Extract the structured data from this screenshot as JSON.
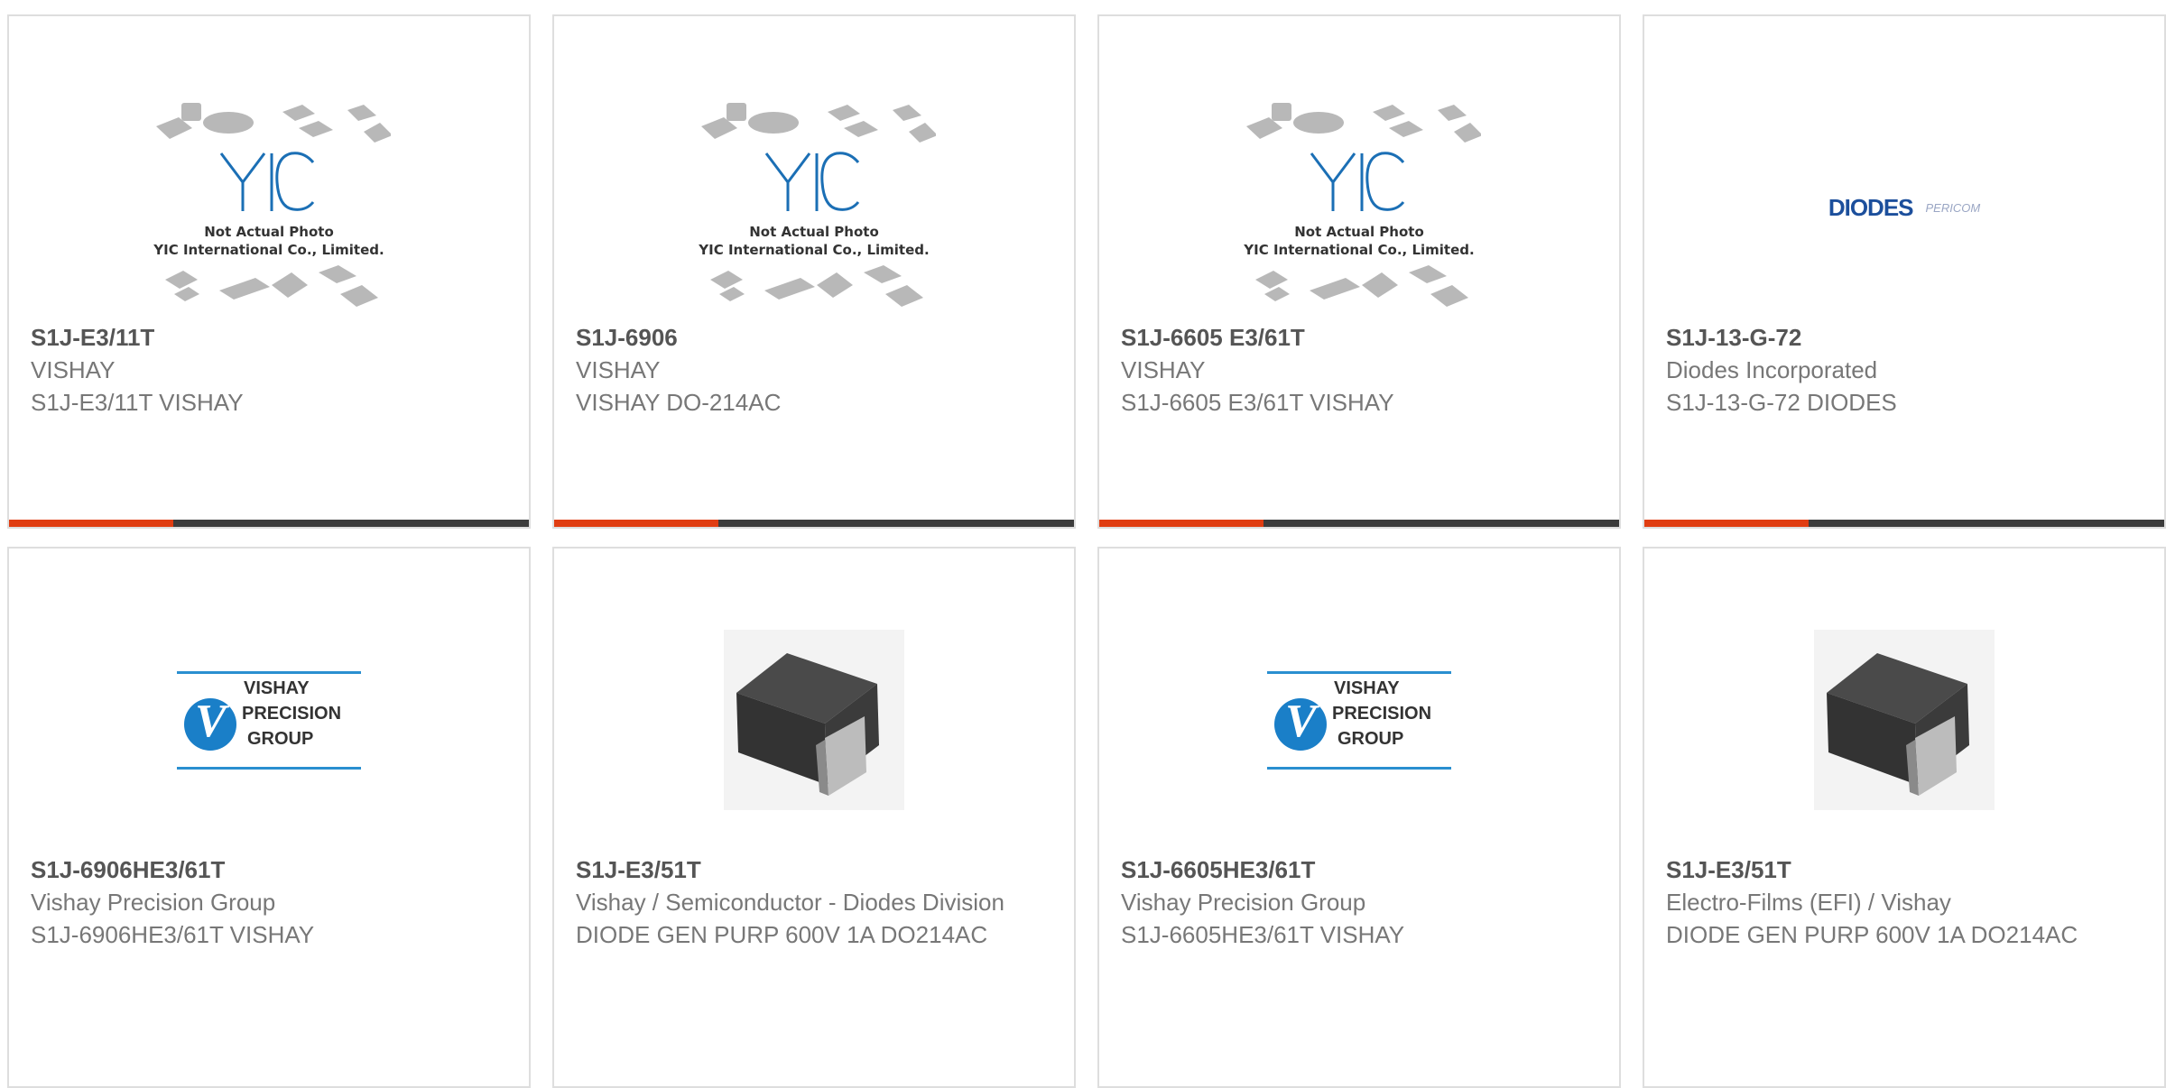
{
  "colors": {
    "accent": "#e03d12",
    "bar": "#3c3c3c",
    "border": "#dedede"
  },
  "yic_placeholder": {
    "line1": "Not Actual Photo",
    "line2": "YIC International Co., Limited."
  },
  "diodes_logo": {
    "brand": "DIODES",
    "sub": "PERICOM"
  },
  "vishay_logo": {
    "w1": "VISHAY",
    "w2": "PRECISION",
    "w3": "GROUP"
  },
  "cards": [
    {
      "pn": "S1J-E3/11T",
      "mfr": "VISHAY",
      "desc": "S1J-E3/11T VISHAY",
      "image": "yic-placeholder"
    },
    {
      "pn": "S1J-6906",
      "mfr": "VISHAY",
      "desc": "VISHAY DO-214AC",
      "image": "yic-placeholder"
    },
    {
      "pn": "S1J-6605 E3/61T",
      "mfr": "VISHAY",
      "desc": "S1J-6605 E3/61T VISHAY",
      "image": "yic-placeholder"
    },
    {
      "pn": "S1J-13-G-72",
      "mfr": "Diodes Incorporated",
      "desc": "S1J-13-G-72 DIODES",
      "image": "diodes-logo"
    },
    {
      "pn": "S1J-6906HE3/61T",
      "mfr": "Vishay Precision Group",
      "desc": "S1J-6906HE3/61T VISHAY",
      "image": "vishay-logo"
    },
    {
      "pn": "S1J-E3/51T",
      "mfr": "Vishay / Semiconductor - Diodes Division",
      "desc": "DIODE GEN PURP 600V 1A DO214AC",
      "image": "smd-diode"
    },
    {
      "pn": "S1J-6605HE3/61T",
      "mfr": "Vishay Precision Group",
      "desc": "S1J-6605HE3/61T VISHAY",
      "image": "vishay-logo"
    },
    {
      "pn": "S1J-E3/51T",
      "mfr": "Electro-Films (EFI) / Vishay",
      "desc": "DIODE GEN PURP 600V 1A DO214AC",
      "image": "smd-diode"
    }
  ]
}
